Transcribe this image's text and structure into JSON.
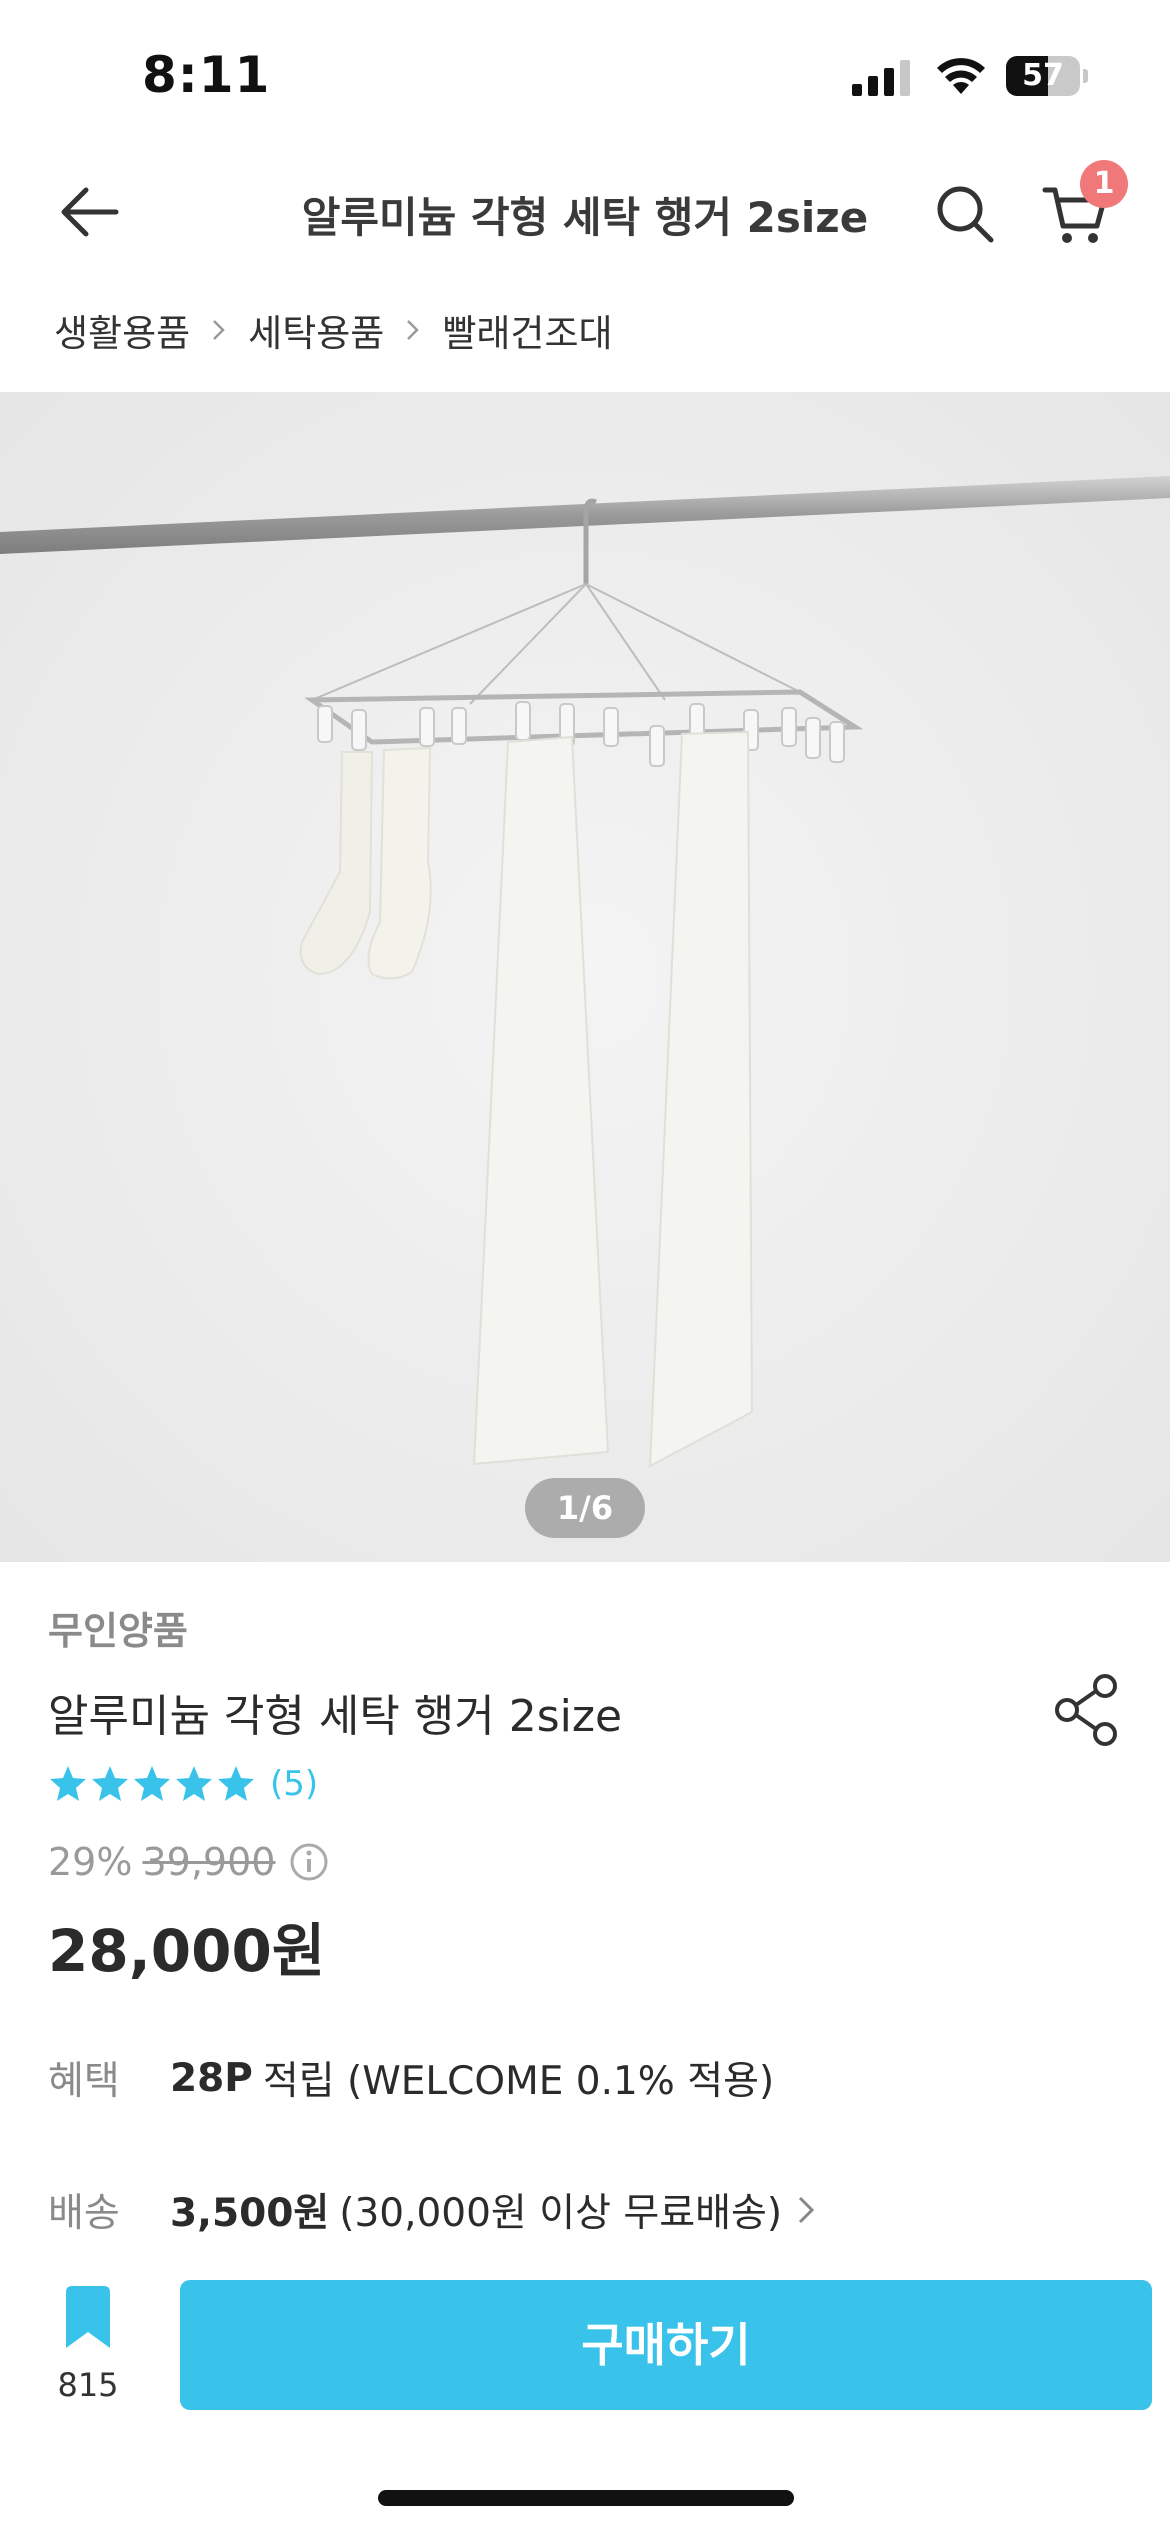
{
  "status_bar": {
    "time": "8:11",
    "battery": "57",
    "battery_level": 0.57
  },
  "header": {
    "title": "알루미늄 각형 세탁 행거 2size",
    "cart_count": "1",
    "back_icon": "arrow-left-icon",
    "search_icon": "search-icon",
    "cart_icon": "cart-icon"
  },
  "breadcrumb": {
    "items": [
      "생활용품",
      "세탁용품",
      "빨래건조대"
    ]
  },
  "gallery": {
    "counter": "1/6"
  },
  "product": {
    "brand": "무인양품",
    "name": "알루미늄 각형 세탁 행거 2size",
    "rating_stars": 5,
    "review_count": "(5)",
    "discount": "29%",
    "original_price": "39,900",
    "sale_price": "28,000원"
  },
  "benefit": {
    "label": "혜택",
    "points": "28P",
    "detail": "적립 (WELCOME 0.1% 적용)"
  },
  "shipping": {
    "label": "배송",
    "fee": "3,500원",
    "detail": "(30,000원 이상 무료배송)"
  },
  "bottom": {
    "wishlist_count": "815",
    "buy_label": "구매하기"
  },
  "colors": {
    "accent": "#3ac3ea",
    "badge": "#f07878",
    "muted_text": "#8a8a8a"
  }
}
